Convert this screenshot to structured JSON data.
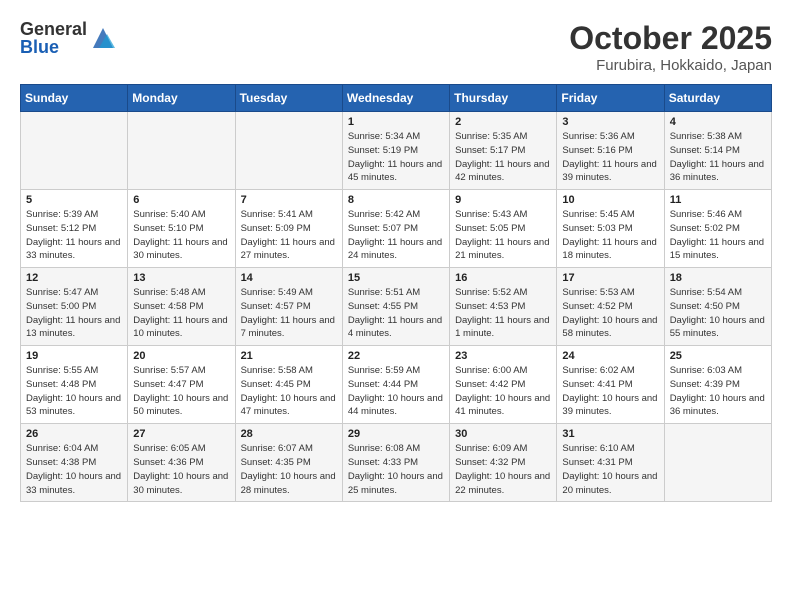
{
  "header": {
    "logo_general": "General",
    "logo_blue": "Blue",
    "month_title": "October 2025",
    "location": "Furubira, Hokkaido, Japan"
  },
  "days_of_week": [
    "Sunday",
    "Monday",
    "Tuesday",
    "Wednesday",
    "Thursday",
    "Friday",
    "Saturday"
  ],
  "weeks": [
    [
      {
        "day": "",
        "sunrise": "",
        "sunset": "",
        "daylight": ""
      },
      {
        "day": "",
        "sunrise": "",
        "sunset": "",
        "daylight": ""
      },
      {
        "day": "",
        "sunrise": "",
        "sunset": "",
        "daylight": ""
      },
      {
        "day": "1",
        "sunrise": "Sunrise: 5:34 AM",
        "sunset": "Sunset: 5:19 PM",
        "daylight": "Daylight: 11 hours and 45 minutes."
      },
      {
        "day": "2",
        "sunrise": "Sunrise: 5:35 AM",
        "sunset": "Sunset: 5:17 PM",
        "daylight": "Daylight: 11 hours and 42 minutes."
      },
      {
        "day": "3",
        "sunrise": "Sunrise: 5:36 AM",
        "sunset": "Sunset: 5:16 PM",
        "daylight": "Daylight: 11 hours and 39 minutes."
      },
      {
        "day": "4",
        "sunrise": "Sunrise: 5:38 AM",
        "sunset": "Sunset: 5:14 PM",
        "daylight": "Daylight: 11 hours and 36 minutes."
      }
    ],
    [
      {
        "day": "5",
        "sunrise": "Sunrise: 5:39 AM",
        "sunset": "Sunset: 5:12 PM",
        "daylight": "Daylight: 11 hours and 33 minutes."
      },
      {
        "day": "6",
        "sunrise": "Sunrise: 5:40 AM",
        "sunset": "Sunset: 5:10 PM",
        "daylight": "Daylight: 11 hours and 30 minutes."
      },
      {
        "day": "7",
        "sunrise": "Sunrise: 5:41 AM",
        "sunset": "Sunset: 5:09 PM",
        "daylight": "Daylight: 11 hours and 27 minutes."
      },
      {
        "day": "8",
        "sunrise": "Sunrise: 5:42 AM",
        "sunset": "Sunset: 5:07 PM",
        "daylight": "Daylight: 11 hours and 24 minutes."
      },
      {
        "day": "9",
        "sunrise": "Sunrise: 5:43 AM",
        "sunset": "Sunset: 5:05 PM",
        "daylight": "Daylight: 11 hours and 21 minutes."
      },
      {
        "day": "10",
        "sunrise": "Sunrise: 5:45 AM",
        "sunset": "Sunset: 5:03 PM",
        "daylight": "Daylight: 11 hours and 18 minutes."
      },
      {
        "day": "11",
        "sunrise": "Sunrise: 5:46 AM",
        "sunset": "Sunset: 5:02 PM",
        "daylight": "Daylight: 11 hours and 15 minutes."
      }
    ],
    [
      {
        "day": "12",
        "sunrise": "Sunrise: 5:47 AM",
        "sunset": "Sunset: 5:00 PM",
        "daylight": "Daylight: 11 hours and 13 minutes."
      },
      {
        "day": "13",
        "sunrise": "Sunrise: 5:48 AM",
        "sunset": "Sunset: 4:58 PM",
        "daylight": "Daylight: 11 hours and 10 minutes."
      },
      {
        "day": "14",
        "sunrise": "Sunrise: 5:49 AM",
        "sunset": "Sunset: 4:57 PM",
        "daylight": "Daylight: 11 hours and 7 minutes."
      },
      {
        "day": "15",
        "sunrise": "Sunrise: 5:51 AM",
        "sunset": "Sunset: 4:55 PM",
        "daylight": "Daylight: 11 hours and 4 minutes."
      },
      {
        "day": "16",
        "sunrise": "Sunrise: 5:52 AM",
        "sunset": "Sunset: 4:53 PM",
        "daylight": "Daylight: 11 hours and 1 minute."
      },
      {
        "day": "17",
        "sunrise": "Sunrise: 5:53 AM",
        "sunset": "Sunset: 4:52 PM",
        "daylight": "Daylight: 10 hours and 58 minutes."
      },
      {
        "day": "18",
        "sunrise": "Sunrise: 5:54 AM",
        "sunset": "Sunset: 4:50 PM",
        "daylight": "Daylight: 10 hours and 55 minutes."
      }
    ],
    [
      {
        "day": "19",
        "sunrise": "Sunrise: 5:55 AM",
        "sunset": "Sunset: 4:48 PM",
        "daylight": "Daylight: 10 hours and 53 minutes."
      },
      {
        "day": "20",
        "sunrise": "Sunrise: 5:57 AM",
        "sunset": "Sunset: 4:47 PM",
        "daylight": "Daylight: 10 hours and 50 minutes."
      },
      {
        "day": "21",
        "sunrise": "Sunrise: 5:58 AM",
        "sunset": "Sunset: 4:45 PM",
        "daylight": "Daylight: 10 hours and 47 minutes."
      },
      {
        "day": "22",
        "sunrise": "Sunrise: 5:59 AM",
        "sunset": "Sunset: 4:44 PM",
        "daylight": "Daylight: 10 hours and 44 minutes."
      },
      {
        "day": "23",
        "sunrise": "Sunrise: 6:00 AM",
        "sunset": "Sunset: 4:42 PM",
        "daylight": "Daylight: 10 hours and 41 minutes."
      },
      {
        "day": "24",
        "sunrise": "Sunrise: 6:02 AM",
        "sunset": "Sunset: 4:41 PM",
        "daylight": "Daylight: 10 hours and 39 minutes."
      },
      {
        "day": "25",
        "sunrise": "Sunrise: 6:03 AM",
        "sunset": "Sunset: 4:39 PM",
        "daylight": "Daylight: 10 hours and 36 minutes."
      }
    ],
    [
      {
        "day": "26",
        "sunrise": "Sunrise: 6:04 AM",
        "sunset": "Sunset: 4:38 PM",
        "daylight": "Daylight: 10 hours and 33 minutes."
      },
      {
        "day": "27",
        "sunrise": "Sunrise: 6:05 AM",
        "sunset": "Sunset: 4:36 PM",
        "daylight": "Daylight: 10 hours and 30 minutes."
      },
      {
        "day": "28",
        "sunrise": "Sunrise: 6:07 AM",
        "sunset": "Sunset: 4:35 PM",
        "daylight": "Daylight: 10 hours and 28 minutes."
      },
      {
        "day": "29",
        "sunrise": "Sunrise: 6:08 AM",
        "sunset": "Sunset: 4:33 PM",
        "daylight": "Daylight: 10 hours and 25 minutes."
      },
      {
        "day": "30",
        "sunrise": "Sunrise: 6:09 AM",
        "sunset": "Sunset: 4:32 PM",
        "daylight": "Daylight: 10 hours and 22 minutes."
      },
      {
        "day": "31",
        "sunrise": "Sunrise: 6:10 AM",
        "sunset": "Sunset: 4:31 PM",
        "daylight": "Daylight: 10 hours and 20 minutes."
      },
      {
        "day": "",
        "sunrise": "",
        "sunset": "",
        "daylight": ""
      }
    ]
  ]
}
